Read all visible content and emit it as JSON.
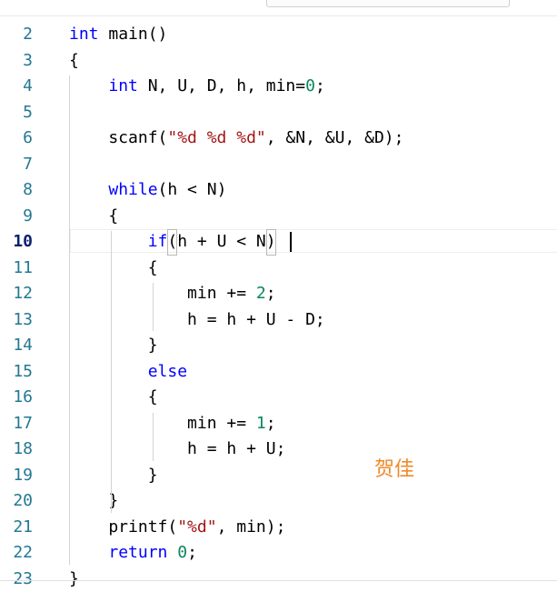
{
  "editor": {
    "active_line": "10",
    "lines": [
      {
        "num": "2",
        "segments": [
          [
            "kw",
            "int"
          ],
          [
            "p",
            " main()"
          ]
        ]
      },
      {
        "num": "3",
        "segments": [
          [
            "p",
            "{"
          ]
        ]
      },
      {
        "num": "4",
        "segments": [
          [
            "p",
            "    "
          ],
          [
            "kw",
            "int"
          ],
          [
            "p",
            " N, U, D, h, min="
          ],
          [
            "num",
            "0"
          ],
          [
            "p",
            ";"
          ]
        ]
      },
      {
        "num": "5",
        "segments": []
      },
      {
        "num": "6",
        "segments": [
          [
            "p",
            "    scanf("
          ],
          [
            "str",
            "\"%d %d %d\""
          ],
          [
            "p",
            ", &N, &U, &D);"
          ]
        ]
      },
      {
        "num": "7",
        "segments": []
      },
      {
        "num": "8",
        "segments": [
          [
            "p",
            "    "
          ],
          [
            "kw",
            "while"
          ],
          [
            "p",
            "(h < N)"
          ]
        ]
      },
      {
        "num": "9",
        "segments": [
          [
            "p",
            "    {"
          ]
        ]
      },
      {
        "num": "10",
        "segments": [
          [
            "p",
            "        "
          ],
          [
            "kw",
            "if"
          ],
          [
            "box",
            "("
          ],
          [
            "p",
            "h + U < N"
          ],
          [
            "box",
            ")"
          ]
        ]
      },
      {
        "num": "11",
        "segments": [
          [
            "p",
            "        {"
          ]
        ]
      },
      {
        "num": "12",
        "segments": [
          [
            "p",
            "            min += "
          ],
          [
            "num",
            "2"
          ],
          [
            "p",
            ";"
          ]
        ]
      },
      {
        "num": "13",
        "segments": [
          [
            "p",
            "            h = h + U - D;"
          ]
        ]
      },
      {
        "num": "14",
        "segments": [
          [
            "p",
            "        }"
          ]
        ]
      },
      {
        "num": "15",
        "segments": [
          [
            "p",
            "        "
          ],
          [
            "kw",
            "else"
          ]
        ]
      },
      {
        "num": "16",
        "segments": [
          [
            "p",
            "        {"
          ]
        ]
      },
      {
        "num": "17",
        "segments": [
          [
            "p",
            "            min += "
          ],
          [
            "num",
            "1"
          ],
          [
            "p",
            ";"
          ]
        ]
      },
      {
        "num": "18",
        "segments": [
          [
            "p",
            "            h = h + U;"
          ]
        ]
      },
      {
        "num": "19",
        "segments": [
          [
            "p",
            "        }"
          ]
        ]
      },
      {
        "num": "20",
        "segments": [
          [
            "p",
            "    }"
          ]
        ]
      },
      {
        "num": "21",
        "segments": [
          [
            "p",
            "    printf("
          ],
          [
            "str",
            "\"%d\""
          ],
          [
            "p",
            ", min);"
          ]
        ]
      },
      {
        "num": "22",
        "segments": [
          [
            "p",
            "    "
          ],
          [
            "kw",
            "return"
          ],
          [
            "p",
            " "
          ],
          [
            "num",
            "0"
          ],
          [
            "p",
            ";"
          ]
        ]
      },
      {
        "num": "23",
        "segments": [
          [
            "p",
            "}"
          ]
        ]
      }
    ],
    "colors": {
      "keyword": "#0000ff",
      "number": "#098658",
      "string": "#a31515",
      "line_number": "#237893",
      "watermark": "#f08a2a"
    }
  },
  "watermark": "贺佳"
}
